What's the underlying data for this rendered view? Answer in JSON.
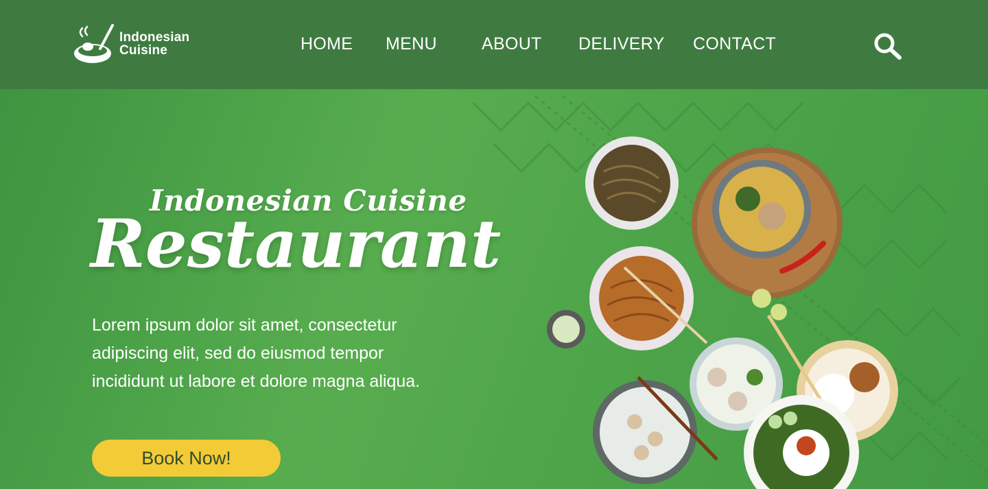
{
  "brand": {
    "line1": "Indonesian",
    "line2": "Cuisine",
    "logo_icon": "wok-icon"
  },
  "nav": {
    "items": [
      {
        "label": "HOME"
      },
      {
        "label": "MENU"
      },
      {
        "label": "ABOUT"
      },
      {
        "label": "DELIVERY"
      },
      {
        "label": "CONTACT"
      }
    ],
    "search_icon": "search-icon"
  },
  "hero": {
    "subtitle": "Indonesian Cuisine",
    "title": "Restaurant",
    "description_lines": [
      "Lorem ipsum dolor sit amet, consectetur",
      "adipiscing elit, sed do eiusmod tempor",
      "incididunt ut labore et dolore magna aliqua."
    ],
    "cta_label": "Book Now!"
  },
  "colors": {
    "header_bg": "#3f7b40",
    "hero_bg": "#4ea449",
    "cta_bg": "#f2cb36",
    "text": "#ffffff"
  }
}
